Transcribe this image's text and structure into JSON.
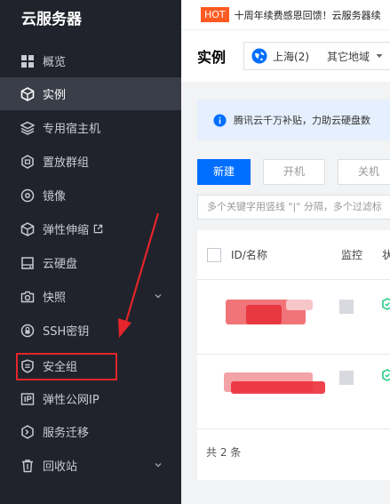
{
  "sidebar": {
    "title": "云服务器",
    "items": [
      {
        "label": "概览",
        "icon": "grid-icon"
      },
      {
        "label": "实例",
        "icon": "cube-icon",
        "active": true
      },
      {
        "label": "专用宿主机",
        "icon": "layers-icon"
      },
      {
        "label": "置放群组",
        "icon": "hexagon-icon"
      },
      {
        "label": "镜像",
        "icon": "disc-icon"
      },
      {
        "label": "弹性伸缩",
        "icon": "box-icon",
        "external": true
      },
      {
        "label": "云硬盘",
        "icon": "drive-icon"
      },
      {
        "label": "快照",
        "icon": "camera-icon",
        "expandable": true
      },
      {
        "label": "SSH密钥",
        "icon": "lock-icon"
      },
      {
        "label": "安全组",
        "icon": "shield-icon",
        "highlighted": true
      },
      {
        "label": "弹性公网IP",
        "icon": "ip-icon"
      },
      {
        "label": "服务迁移",
        "icon": "migrate-icon"
      },
      {
        "label": "回收站",
        "icon": "trash-icon",
        "expandable": true
      }
    ]
  },
  "hotbar": {
    "badge": "HOT",
    "text": "十周年续费感恩回馈！云服务器续"
  },
  "header": {
    "title": "实例",
    "region": "上海(2)",
    "other_region": "其它地域"
  },
  "notice": {
    "text": "腾讯云千万补贴，力助云硬盘数"
  },
  "toolbar": {
    "new_label": "新建",
    "start_label": "开机",
    "stop_label": "关机"
  },
  "search": {
    "placeholder": "多个关键字用竖线 \"|\" 分隔，多个过滤标"
  },
  "table": {
    "columns": [
      "ID/名称",
      "监控",
      "状"
    ],
    "rows": [
      {
        "status": "running"
      },
      {
        "status": "running"
      }
    ],
    "footer": "共 2 条"
  },
  "colors": {
    "accent": "#006eff",
    "highlight": "#e5242b",
    "sidebar_bg": "#20232b",
    "success": "#29cc85"
  }
}
